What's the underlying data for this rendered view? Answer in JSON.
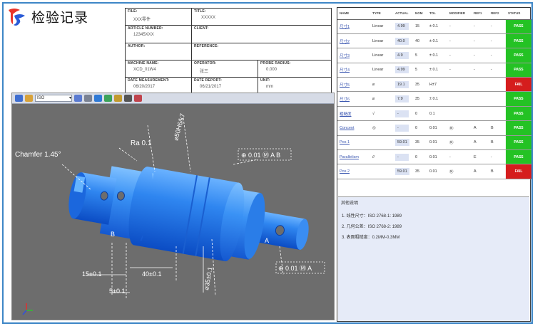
{
  "app": {
    "title": "检验记录"
  },
  "info": {
    "file_label": "FILE:",
    "file_value": "XXX零件",
    "title_label": "TITLE:",
    "title_value": "XXXXX",
    "article_label": "ARTICLE NUMBER:",
    "article_value": "12345XXX",
    "client_label": "CLIENT:",
    "client_value": "",
    "author_label": "AUTHOR:",
    "author_value": "",
    "reference_label": "REFERENCE:",
    "reference_value": "",
    "machine_label": "MACHINE NAME:",
    "machine_value": "XCD_01W4",
    "operator_label": "OPERATOR:",
    "operator_value": "张三",
    "probe_label": "PROBE RADIUS:",
    "probe_value": "0.000",
    "measure_date_label": "DATE MEASUREMENT:",
    "measure_date_value": "06/20/2017",
    "report_date_label": "DATE REPORT:",
    "report_date_value": "06/21/2017",
    "unit_label": "UNIT:",
    "unit_value": "mm"
  },
  "viewer": {
    "view_name": "ISO"
  },
  "inspection": {
    "columns": [
      "NAME",
      "TYPE",
      "ACTUAL",
      "NOM",
      "TOL",
      "MODIFIER",
      "REF1",
      "REF2",
      "STATUS"
    ],
    "rows": [
      {
        "name": "尺寸1",
        "type": "Linear",
        "actual": "4.99",
        "nom": "15",
        "tol": "± 0.1",
        "modifier": "-",
        "ref1": "-",
        "ref2": "-",
        "status": "PASS"
      },
      {
        "name": "尺寸2",
        "type": "Linear",
        "actual": "40.0",
        "nom": "40",
        "tol": "± 0.1",
        "modifier": "-",
        "ref1": "-",
        "ref2": "-",
        "status": "PASS"
      },
      {
        "name": "尺寸3",
        "type": "Linear",
        "actual": "4.9",
        "nom": "5",
        "tol": "± 0.1",
        "modifier": "-",
        "ref1": "-",
        "ref2": "-",
        "status": "PASS"
      },
      {
        "name": "尺寸4",
        "type": "Linear",
        "actual": "4.99",
        "nom": "5",
        "tol": "± 0.1",
        "modifier": "-",
        "ref1": "-",
        "ref2": "-",
        "status": "PASS"
      },
      {
        "name": "尺寸5",
        "type": "⌀",
        "actual": "19.1",
        "nom": "35",
        "tol": "H±7",
        "modifier": "",
        "ref1": "",
        "ref2": "",
        "status": "FAIL"
      },
      {
        "name": "尺寸6",
        "type": "⌀",
        "actual": "7.9",
        "nom": "35",
        "tol": "± 0.1",
        "modifier": "",
        "ref1": "",
        "ref2": "",
        "status": "PASS"
      },
      {
        "name": "粗糙度",
        "type": "√",
        "actual": "-",
        "nom": "0",
        "tol": "0.1",
        "modifier": "",
        "ref1": "",
        "ref2": "",
        "status": "PASS"
      },
      {
        "name": "Concent",
        "type": "◎",
        "actual": "-",
        "nom": "0",
        "tol": "0.01",
        "modifier": "Ⓜ",
        "ref1": "A",
        "ref2": "B",
        "status": "PASS"
      },
      {
        "name": "Pos 1",
        "type": "",
        "actual": "59.01",
        "nom": "35",
        "tol": "0.01",
        "modifier": "Ⓜ",
        "ref1": "A",
        "ref2": "B",
        "status": "PASS"
      },
      {
        "name": "Parallelism",
        "type": "//",
        "actual": "-",
        "nom": "0",
        "tol": "0.01",
        "modifier": "-",
        "ref1": "E",
        "ref2": "-",
        "status": "PASS"
      },
      {
        "name": "Pos 2",
        "type": "",
        "actual": "59.01",
        "nom": "35",
        "tol": "0.01",
        "modifier": "Ⓜ",
        "ref1": "A",
        "ref2": "B",
        "status": "FAIL"
      }
    ]
  },
  "remarks": {
    "title": "其他说明",
    "lines": [
      "1. 线性尺寸：ISO 2768-1: 1989",
      "2. 几何公差：ISO 2768-2: 1989",
      "3. 表面粗糙度：0.2MM-0.3MM"
    ]
  },
  "cad": {
    "chamfer": "Chamfer 1.45°",
    "ra": "Ra 0.1",
    "dia_top": "⌀50H6/k7",
    "pos_top": "⊕ 0.01 Ⓜ A B",
    "dim_15": "15±0.1",
    "dim_40": "40±0.1",
    "dim_5": "5±0.1",
    "dia_35": "⌀35±0.1",
    "pos_bot": "⊕ 0.01 Ⓜ A",
    "datum_b": "B",
    "datum_a": "A"
  },
  "colors": {
    "part": "#2f86f0",
    "frame": "#3d86c6",
    "pass": "#24c224",
    "fail": "#d51d1d"
  }
}
